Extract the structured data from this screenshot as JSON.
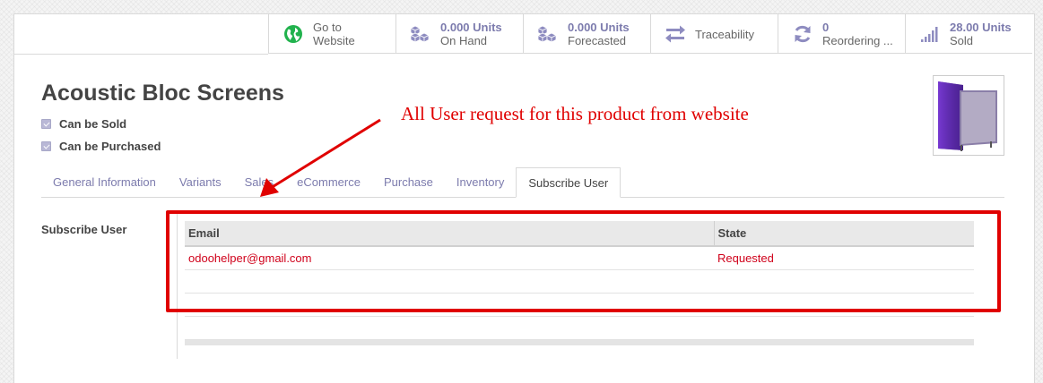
{
  "stat_buttons": [
    {
      "line1": "Go to",
      "line2": "Website",
      "icon": "globe-icon",
      "emphasis": false
    },
    {
      "line1": "0.000 Units",
      "line2": "On Hand",
      "icon": "cubes-icon",
      "emphasis": true
    },
    {
      "line1": "0.000 Units",
      "line2": "Forecasted",
      "icon": "cubes-icon",
      "emphasis": true
    },
    {
      "line1": "Traceability",
      "line2": "",
      "icon": "exchange-arrows-icon",
      "emphasis": false
    },
    {
      "line1": "0",
      "line2": "Reordering ...",
      "icon": "refresh-icon",
      "emphasis": true
    },
    {
      "line1": "28.00 Units",
      "line2": "Sold",
      "icon": "signal-bars-icon",
      "emphasis": true
    }
  ],
  "product": {
    "name": "Acoustic Bloc Screens",
    "can_be_sold": "Can be Sold",
    "can_be_purchased": "Can be Purchased",
    "image_icon": "product-screen-image"
  },
  "tabs": [
    {
      "label": "General Information",
      "active": false
    },
    {
      "label": "Variants",
      "active": false
    },
    {
      "label": "Sales",
      "active": false
    },
    {
      "label": "eCommerce",
      "active": false
    },
    {
      "label": "Purchase",
      "active": false
    },
    {
      "label": "Inventory",
      "active": false
    },
    {
      "label": "Subscribe User",
      "active": true
    }
  ],
  "subscribe": {
    "label": "Subscribe User",
    "columns": [
      "Email",
      "State"
    ],
    "rows": [
      {
        "email": "odoohelper@gmail.com",
        "state": "Requested"
      }
    ]
  },
  "annotation": {
    "text": "All User request for this product from website",
    "color": "#e00000"
  },
  "colors": {
    "accent": "#7c7bad",
    "globe_green": "#21b24d",
    "row_text": "#d0021b"
  }
}
